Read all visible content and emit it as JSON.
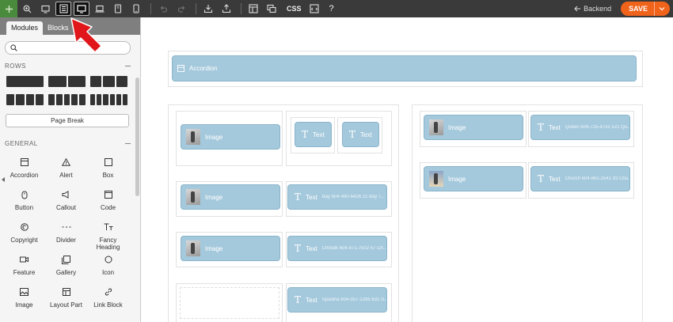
{
  "toolbar": {
    "css_label": "CSS",
    "help_label": "?",
    "backend_label": "Backend",
    "save_label": "SAVE"
  },
  "sidebar": {
    "tabs": [
      "Modules",
      "Blocks"
    ],
    "rows_header": "ROWS",
    "page_break_label": "Page Break",
    "general_header": "GENERAL",
    "modules": [
      {
        "label": "Accordion",
        "icon": "accordion-icon"
      },
      {
        "label": "Alert",
        "icon": "alert-icon"
      },
      {
        "label": "Box",
        "icon": "box-icon"
      },
      {
        "label": "Button",
        "icon": "button-icon"
      },
      {
        "label": "Callout",
        "icon": "callout-icon"
      },
      {
        "label": "Code",
        "icon": "code-icon"
      },
      {
        "label": "Copyright",
        "icon": "copyright-icon"
      },
      {
        "label": "Divider",
        "icon": "divider-icon"
      },
      {
        "label": "Fancy Heading",
        "icon": "fancy-heading-icon"
      },
      {
        "label": "Feature",
        "icon": "feature-icon"
      },
      {
        "label": "Gallery",
        "icon": "gallery-icon"
      },
      {
        "label": "Icon",
        "icon": "icon-icon"
      },
      {
        "label": "Image",
        "icon": "image-icon"
      },
      {
        "label": "Layout Part",
        "icon": "layout-part-icon"
      },
      {
        "label": "Link Block",
        "icon": "link-block-icon"
      }
    ]
  },
  "canvas": {
    "accordion_label": "Accordion",
    "image_label": "Image",
    "text_label": "Text",
    "text_items": {
      "left_row2": "Bay 604-490-6426 21 Bay T...",
      "left_row3": "Chinatk 604-871-7502 57 Ch...",
      "left_row4": "Spadina 604-357-1395 631 S...",
      "right_row1": "Queen 604-725-4731 521 Qu...",
      "right_row2": "Church 604-861-2541 93 Chu..."
    }
  },
  "colors": {
    "toolbar_bg": "#3a3a3a",
    "save_orange": "#f0631b",
    "module_blue": "#a5c9dc",
    "add_green": "#4a8a3c",
    "annotation_red": "#e0161a"
  }
}
